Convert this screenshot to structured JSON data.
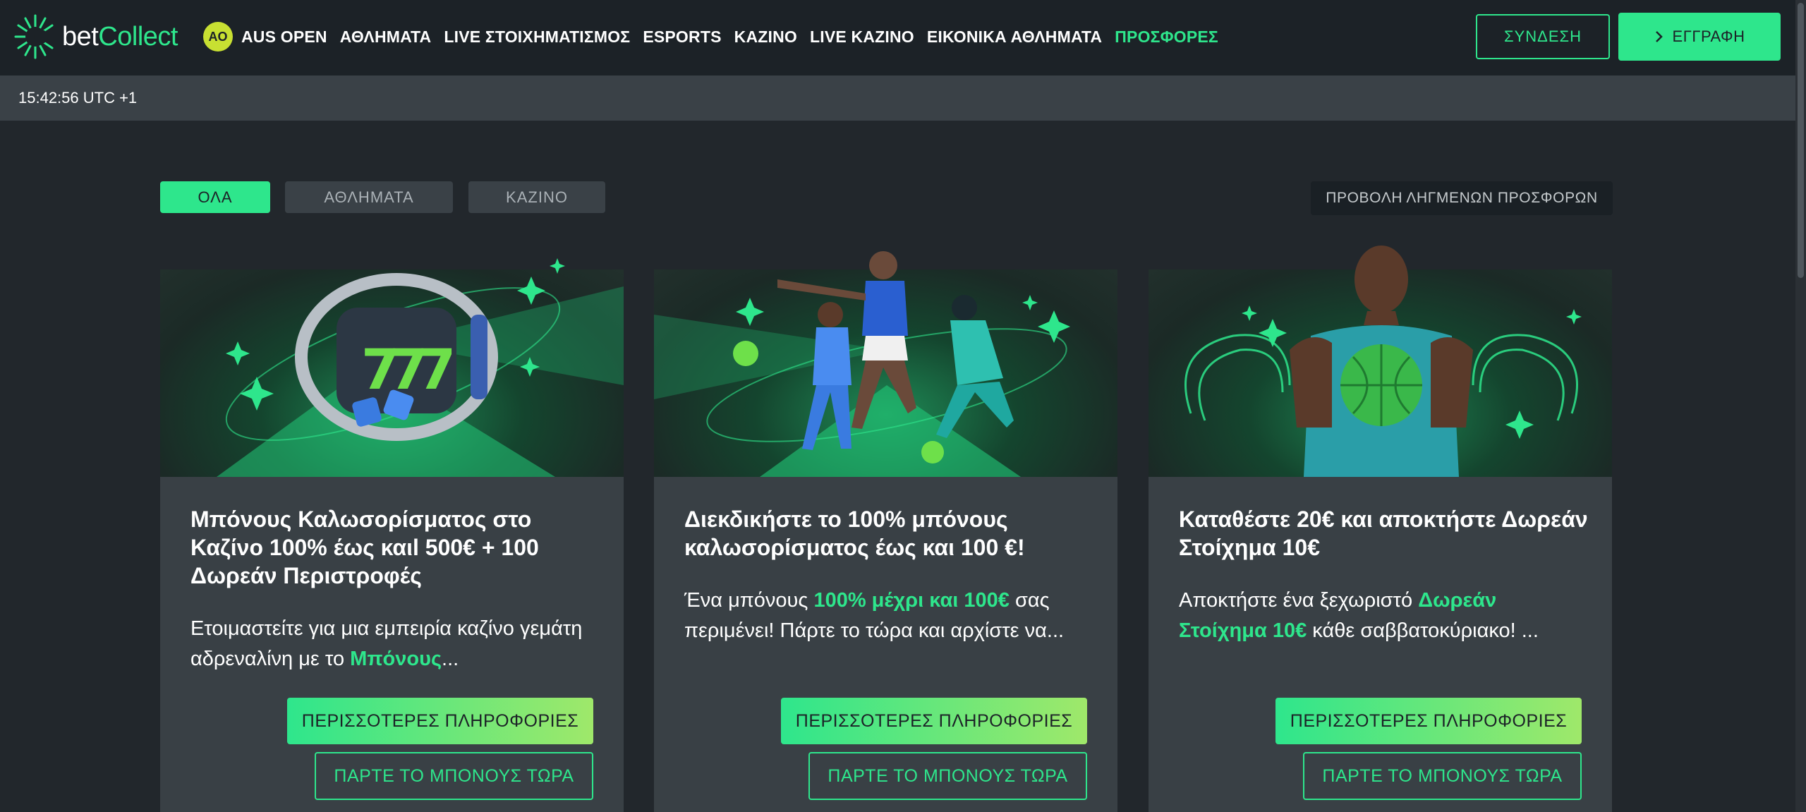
{
  "brand": {
    "bet": "bet",
    "collect": "Collect",
    "logo_icon": "burst-logo-icon"
  },
  "nav": {
    "ao_badge": "AO",
    "items": [
      {
        "label": "AUS OPEN",
        "active": false
      },
      {
        "label": "ΑΘΛΗΜΑΤΑ",
        "active": false
      },
      {
        "label": "LIVE ΣΤΟΙΧΗΜΑΤΙΣΜΟΣ",
        "active": false
      },
      {
        "label": "ESPORTS",
        "active": false
      },
      {
        "label": "ΚΑΖΙΝΟ",
        "active": false
      },
      {
        "label": "LIVE ΚΑΖΙΝΟ",
        "active": false
      },
      {
        "label": "ΕΙΚΟΝΙΚΑ ΑΘΛΗΜΑΤΑ",
        "active": false
      },
      {
        "label": "ΠΡΟΣΦΟΡΕΣ",
        "active": true
      }
    ]
  },
  "auth": {
    "login_label": "ΣΥΝΔΕΣΗ",
    "register_label": "ΕΓΓΡΑΦΗ"
  },
  "timebar": {
    "time": "15:42:56 UTC +1"
  },
  "filters": {
    "all": "ΟΛΑ",
    "sports": "ΑΘΛΗΜΑΤΑ",
    "casino": "ΚΑΖΙΝΟ",
    "expired": "ΠΡΟΒΟΛΗ ΛΗΓΜΕΝΩΝ ΠΡΟΣΦΟΡΩΝ"
  },
  "cards": [
    {
      "image": "casino-slot-777-illustration",
      "title": "Μπόνους Καλωσορίσματος στο Καζίνο 100% έως καιl 500€ + 100 Δωρεάν Περιστροφές",
      "desc_a": "Ετοιμαστείτε για μια εμπειρία καζίνο γεμάτη αδρεναλίνη με το ",
      "desc_hl": "Μπόνους",
      "desc_b": "...",
      "info_label": "ΠΕΡΙΣΣΟΤΕΡΕΣ ΠΛΗΡΟΦΟΡΙΕΣ",
      "bonus_label": "ΠΑΡΤΕ ΤΟ ΜΠΟΝΟΥΣ ΤΩΡΑ"
    },
    {
      "image": "multi-sport-athletes-illustration",
      "title": "Διεκδικήστε το 100% μπόνους καλωσορίσματος έως και 100 €!",
      "desc_a": "Ένα μπόνους ",
      "desc_hl": "100% μέχρι και 100€",
      "desc_b": " σας περιμένει! Πάρτε το τώρα και αρχίστε να...",
      "info_label": "ΠΕΡΙΣΣΟΤΕΡΕΣ ΠΛΗΡΟΦΟΡΙΕΣ",
      "bonus_label": "ΠΑΡΤΕ ΤΟ ΜΠΟΝΟΥΣ ΤΩΡΑ"
    },
    {
      "image": "basketball-player-illustration",
      "title": "Καταθέστε 20€ και αποκτήστε Δωρεάν Στοίχημα 10€",
      "desc_a": "Αποκτήστε ένα ξεχωριστό ",
      "desc_hl": "Δωρεάν Στοίχημα 10€",
      "desc_b": " κάθε σαββατοκύριακο! ...",
      "info_label": "ΠΕΡΙΣΣΟΤΕΡΕΣ ΠΛΗΡΟΦΟΡΙΕΣ",
      "bonus_label": "ΠΑΡΤΕ ΤΟ ΜΠΟΝΟΥΣ ΤΩΡΑ"
    }
  ]
}
